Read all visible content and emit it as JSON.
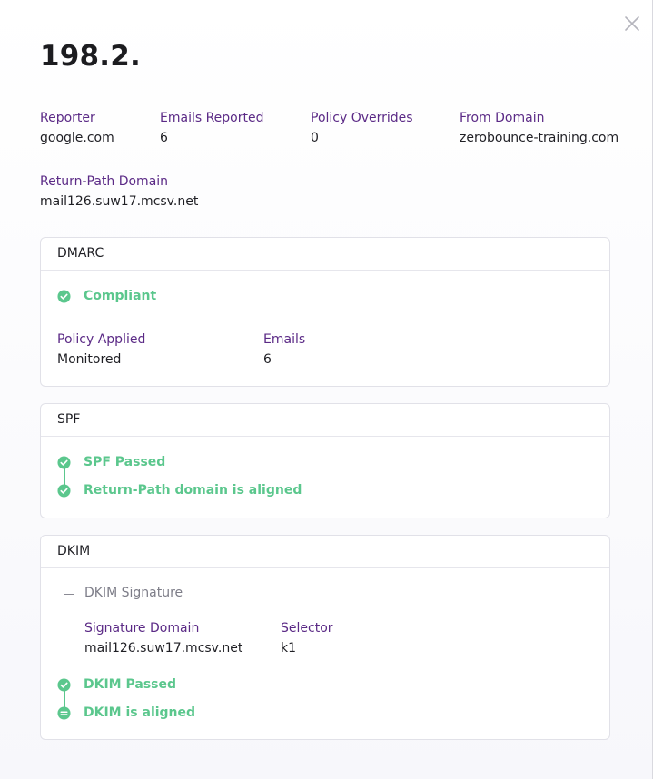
{
  "title": "198.2.",
  "colors": {
    "accent_label": "#5b2a86",
    "success": "#5bc78d"
  },
  "meta": {
    "reporter": {
      "label": "Reporter",
      "value": "google.com"
    },
    "emails_reported": {
      "label": "Emails Reported",
      "value": "6"
    },
    "policy_overrides": {
      "label": "Policy Overrides",
      "value": "0"
    },
    "from_domain": {
      "label": "From Domain",
      "value": "zerobounce-training.com"
    },
    "return_path_domain": {
      "label": "Return-Path Domain",
      "value": "mail126.suw17.mcsv.net"
    }
  },
  "dmarc": {
    "header": "DMARC",
    "status": "Compliant",
    "policy_applied": {
      "label": "Policy Applied",
      "value": "Monitored"
    },
    "emails": {
      "label": "Emails",
      "value": "6"
    }
  },
  "spf": {
    "header": "SPF",
    "checks": [
      "SPF Passed",
      "Return-Path domain is aligned"
    ]
  },
  "dkim": {
    "header": "DKIM",
    "signature_title": "DKIM Signature",
    "signature_domain": {
      "label": "Signature Domain",
      "value": "mail126.suw17.mcsv.net"
    },
    "selector": {
      "label": "Selector",
      "value": "k1"
    },
    "checks": [
      "DKIM Passed",
      "DKIM is aligned"
    ]
  },
  "icons": {
    "close": "close-icon",
    "check": "check-circle-icon",
    "equal": "equal-circle-icon"
  }
}
